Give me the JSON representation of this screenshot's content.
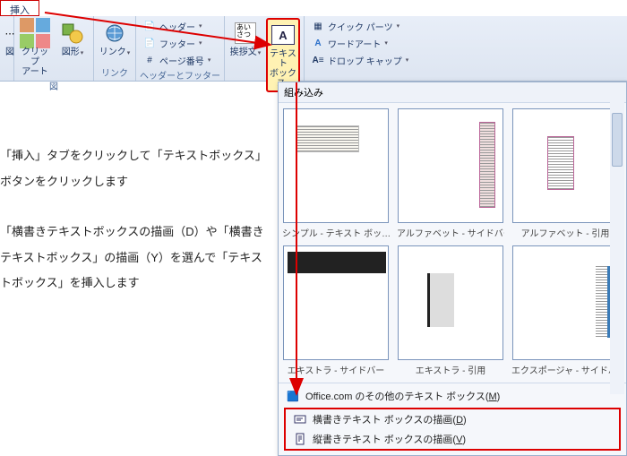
{
  "tab": {
    "active": "挿入"
  },
  "ribbon": {
    "clipart": {
      "label": "クリップ\nアート"
    },
    "shapes": {
      "label": "図形"
    },
    "link": {
      "label": "リンク"
    },
    "header": "ヘッダー",
    "footer": "フッター",
    "pagenum": "ページ番号",
    "hf_group": "ヘッダーとフッター",
    "salutation": {
      "label": "挨拶文"
    },
    "textbox": {
      "label": "テキスト\nボックス"
    },
    "quickparts": "クイック パーツ",
    "wordart": "ワードアート",
    "dropcap": "ドロップ キャップ"
  },
  "instructions": {
    "p1": "「挿入」タブをクリックして「テキストボックス」ボタンをクリックします",
    "p2": "「横書きテキストボックスの描画（D）や「横書きテキストボックス」の描画（Y）を選んで「テキストボックス」を挿入します"
  },
  "dropdown": {
    "header": "組み込み",
    "items": [
      "シンプル - テキスト ボッ…",
      "アルファベット - サイドバー",
      "アルファベット - 引用",
      "エキストラ - サイドバー",
      "エキストラ - 引用",
      "エクスポージャ - サイドバー"
    ],
    "office_more": "Office.com のその他のテキスト ボックス(",
    "office_more_key": "M",
    "draw_h": "横書きテキスト ボックスの描画(",
    "draw_h_key": "D",
    "draw_v": "縦書きテキスト ボックスの描画(",
    "draw_v_key": "V"
  }
}
